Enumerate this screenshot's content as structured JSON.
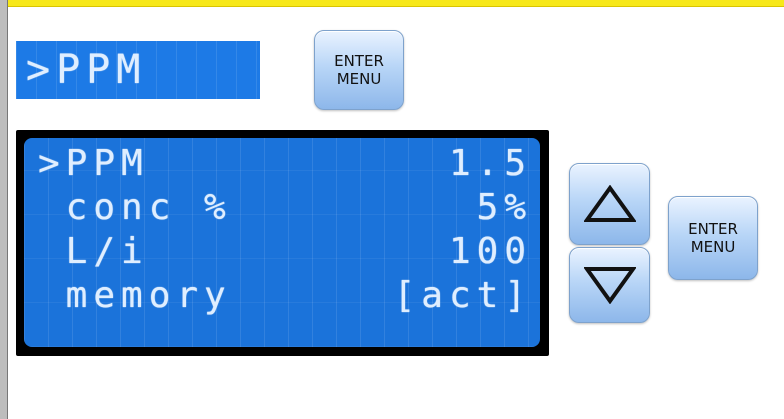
{
  "top_display": {
    "text": ">PPM"
  },
  "buttons": {
    "enter_top": {
      "line1": "ENTER",
      "line2": "MENU"
    },
    "enter_right": {
      "line1": "ENTER",
      "line2": "MENU"
    },
    "up": {
      "icon": "triangle-up-icon"
    },
    "down": {
      "icon": "triangle-down-icon"
    }
  },
  "lcd_rows": [
    {
      "label": ">PPM",
      "value": "1.5"
    },
    {
      "label": " conc %",
      "value": "5%"
    },
    {
      "label": " L/i",
      "value": "100"
    },
    {
      "label": " memory",
      "value": "[act]"
    }
  ],
  "colors": {
    "lcd_blue": "#1b73da",
    "lcd_text": "#dfeeff",
    "button_gradient_top": "#eaf3ff",
    "button_gradient_bottom": "#8db7ea"
  }
}
